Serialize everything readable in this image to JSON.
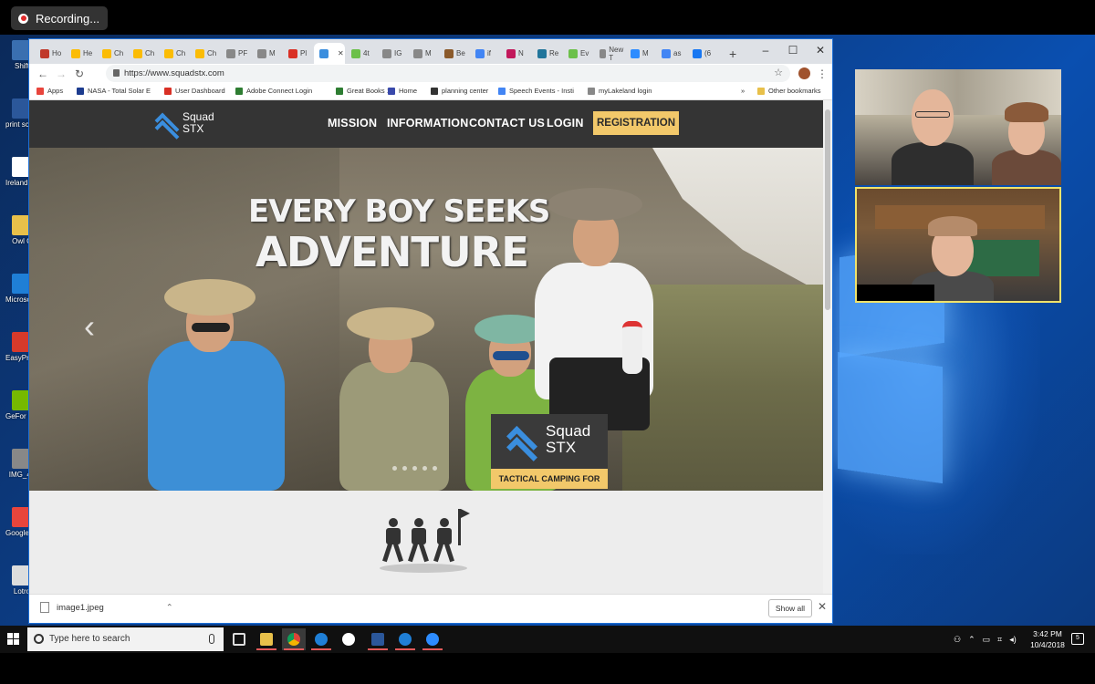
{
  "recording": {
    "label": "Recording..."
  },
  "desktop": {
    "icons": [
      {
        "label": "Shift",
        "color": "#3a6fb0"
      },
      {
        "label": "print science project",
        "color": "#2b579a"
      },
      {
        "label": "Ireland Support",
        "color": "#ffffff"
      },
      {
        "label": "Owl C",
        "color": "#e8c04a"
      },
      {
        "label": "Microsoft Edge",
        "color": "#1f7fd6"
      },
      {
        "label": "EasyPr Readin",
        "color": "#d63a2b"
      },
      {
        "label": "GeFor Experie",
        "color": "#76b900"
      },
      {
        "label": "IMG_46",
        "color": "#888888"
      },
      {
        "label": "Google Chrom",
        "color": "#e8453c"
      },
      {
        "label": "Lotro",
        "color": "#dddddd"
      }
    ]
  },
  "browser": {
    "tabs": [
      {
        "label": "Ho",
        "color": "#c0392b"
      },
      {
        "label": "He",
        "color": "#fbbc05"
      },
      {
        "label": "Ch",
        "color": "#fbbc05"
      },
      {
        "label": "Ch",
        "color": "#fbbc05"
      },
      {
        "label": "Ch",
        "color": "#fbbc05"
      },
      {
        "label": "Ch",
        "color": "#fbbc05"
      },
      {
        "label": "PF",
        "color": "#888888"
      },
      {
        "label": "M",
        "color": "#888888"
      },
      {
        "label": "Pl",
        "color": "#d93025"
      },
      {
        "label": "",
        "color": "#3a8ede",
        "active": true
      },
      {
        "label": "4t",
        "color": "#6cc04a"
      },
      {
        "label": "IG",
        "color": "#888888"
      },
      {
        "label": "M",
        "color": "#888888"
      },
      {
        "label": "Be",
        "color": "#8b5a2b"
      },
      {
        "label": "if",
        "color": "#4285f4"
      },
      {
        "label": "N",
        "color": "#c2185b"
      },
      {
        "label": "Re",
        "color": "#21759b"
      },
      {
        "label": "Ev",
        "color": "#6cc04a"
      },
      {
        "label": "New T",
        "color": "#888888"
      },
      {
        "label": "M",
        "color": "#2d8cff"
      },
      {
        "label": "as",
        "color": "#4285f4"
      },
      {
        "label": "(6",
        "color": "#1877f2"
      }
    ],
    "new_tab": "+",
    "url": "https://www.squadstx.com",
    "bookmarks": [
      {
        "label": "Apps",
        "color": "#e8453c"
      },
      {
        "label": "NASA - Total Solar E",
        "color": "#1d3c8f"
      },
      {
        "label": "User Dashboard",
        "color": "#d93025"
      },
      {
        "label": "Adobe Connect Login",
        "color": "#2e7d32"
      },
      {
        "label": "Great Books 1",
        "color": "#2e7d32"
      },
      {
        "label": "Home",
        "color": "#3949ab"
      },
      {
        "label": "planning center",
        "color": "#333333"
      },
      {
        "label": "Speech Events - Insti",
        "color": "#4285f4"
      },
      {
        "label": "myLakeland login",
        "color": "#888888"
      }
    ],
    "bookmarks_more": "»",
    "other_bookmarks": "Other bookmarks",
    "download": {
      "file": "image1.jpeg",
      "show_all": "Show all"
    }
  },
  "site": {
    "logo_line1": "Squad",
    "logo_line2": "STX",
    "nav": [
      "MISSION",
      "INFORMATION",
      "CONTACT US",
      "LOGIN"
    ],
    "cta": "REGISTRATION",
    "hero_line1": "EVERY BOY SEEKS",
    "hero_line2": "ADVENTURE",
    "badge_line1": "Squad",
    "badge_line2": "STX",
    "badge_tagline": "TACTICAL CAMPING FOR BOYS",
    "accent": "#f2c86a",
    "brand_blue": "#3a8ede"
  },
  "taskbar": {
    "search_placeholder": "Type here to search",
    "time": "3:42 PM",
    "date": "10/4/2018",
    "notifications": "5"
  }
}
